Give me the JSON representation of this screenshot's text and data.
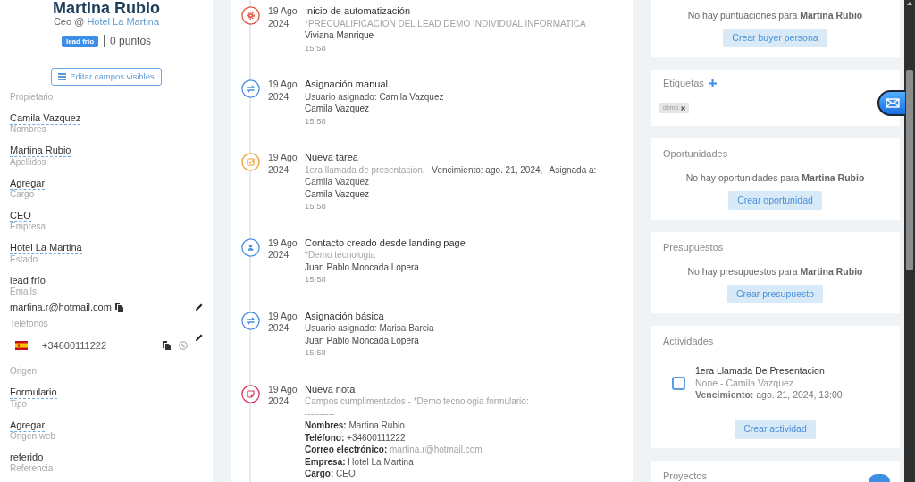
{
  "contact": {
    "name": "Martina Rubio",
    "role": "Ceo @",
    "company": "Hotel La Martina",
    "badge": "lead frío",
    "points": "0 puntos",
    "edit_button": "Editar campos visibles"
  },
  "fields": [
    {
      "kind": "editable",
      "label": "Propietario",
      "value": "Camila Vazquez"
    },
    {
      "kind": "editable",
      "label": "Nombres",
      "value": "Martina Rubio"
    },
    {
      "kind": "editable",
      "label": "Apellidos",
      "value": "Agregar"
    },
    {
      "kind": "editable",
      "label": "Cargo",
      "value": "CEO"
    },
    {
      "kind": "editable",
      "label": "Empresa",
      "value": "Hotel La Martina"
    },
    {
      "kind": "editable",
      "label": "Estado",
      "value": "lead frío"
    },
    {
      "kind": "email",
      "label": "Emails",
      "value": "martina.r@hotmail.com"
    },
    {
      "kind": "phone",
      "label": "Teléfonos",
      "value": "+34600111222"
    },
    {
      "kind": "editable",
      "label": "Origen",
      "value": "Formulario"
    },
    {
      "kind": "editable",
      "label": "Tipo",
      "value": "Agregar"
    },
    {
      "kind": "plain",
      "label": "Origen web",
      "value": "referido"
    },
    {
      "kind": "plain",
      "label": "Referencia"
    }
  ],
  "timeline": [
    {
      "kind": "automation",
      "date": "19 Ago 2024",
      "title": "Inicio de automatización",
      "description": [
        {
          "text": "*PRECUALIFICACION DEL LEAD DEMO INDIVIDUAL INFORMATICA",
          "muted": true
        }
      ],
      "author": "Viviana Manrique",
      "time": "15:58"
    },
    {
      "kind": "assignment",
      "date": "19 Ago 2024",
      "title": "Asignación manual",
      "description": [
        {
          "text": "Usuario asignado: Camila Vazquez",
          "muted": false
        }
      ],
      "author": "Camila Vazquez",
      "time": "15:58"
    },
    {
      "kind": "task",
      "date": "19 Ago 2024",
      "title": "Nueva tarea",
      "description": [
        {
          "text": "1era llamada de presentacion,",
          "muted": true
        },
        {
          "text": "Vencimiento: ago. 21, 2024,",
          "muted": false
        },
        {
          "text": "Asignada a: Camila Vazquez",
          "muted": false
        }
      ],
      "author": "Camila Vazquez",
      "time": "15:58"
    },
    {
      "kind": "contact",
      "date": "19 Ago 2024",
      "title": "Contacto creado desde landing page",
      "description": [
        {
          "text": "*Demo tecnologia",
          "muted": true
        }
      ],
      "author": "Juan Pablo Moncada Lopera",
      "time": "15:58"
    },
    {
      "kind": "assignment",
      "date": "19 Ago 2024",
      "title": "Asignación básica",
      "description": [
        {
          "text": "Usuario asignado: Marisa Barcia",
          "muted": false
        }
      ],
      "author": "Juan Pablo Moncada Lopera",
      "time": "15:58"
    },
    {
      "kind": "note",
      "date": "19 Ago 2024",
      "title": "Nueva nota",
      "description": [
        {
          "text": "Campos cumplimentados - *Demo tecnologia formulario:",
          "muted": true
        }
      ],
      "separator": "----------",
      "fields": [
        {
          "label": "Nombres:",
          "value": "Martina Rubio",
          "muted": false
        },
        {
          "label": "Teléfono:",
          "value": "+34600111222",
          "muted": false
        },
        {
          "label": "Correo electrónico:",
          "value": "martina.r@hotmail.com",
          "muted": true
        },
        {
          "label": "Empresa:",
          "value": "Hotel La Martina",
          "muted": false
        },
        {
          "label": "Cargo:",
          "value": "CEO",
          "muted": false
        }
      ]
    }
  ],
  "panels": [
    {
      "kind": "empty",
      "message": "No hay puntuaciones para **Martina Rubio**",
      "button": "Crear buyer persona"
    },
    {
      "kind": "tags",
      "title": "Etiquetas",
      "tags": [
        {
          "label": "demo"
        }
      ]
    },
    {
      "kind": "empty",
      "title": "Oportunidades",
      "message": "No hay oportunidades para **Martina Rubio**",
      "button": "Crear oportunidad"
    },
    {
      "kind": "empty",
      "title": "Presupuestos",
      "message": "No hay presupuestos para **Martina Rubio**",
      "button": "Crear presupuesto"
    },
    {
      "kind": "activities",
      "title": "Actividades",
      "activities": [
        {
          "title": "1era Llamada De Presentacion",
          "subtitle": "None - Camila Vazquez",
          "due": "**Vencimiento:** ago. 21, 2024, 13:00",
          "checked": false
        }
      ],
      "button": "Crear actividad"
    },
    {
      "kind": "empty",
      "title": "Proyectos"
    }
  ]
}
